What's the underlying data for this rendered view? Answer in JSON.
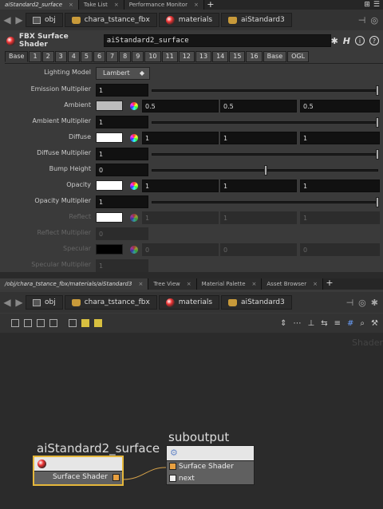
{
  "top_tabs": {
    "tabs": [
      "aiStandard2_surface",
      "Take List",
      "Performance Monitor"
    ],
    "plus": "+"
  },
  "path1": {
    "crumbs": [
      "obj",
      "chara_tstance_fbx",
      "materials",
      "aiStandard3"
    ]
  },
  "header": {
    "type_label": "FBX Surface Shader",
    "node_name": "aiStandard2_surface",
    "help_icon": "H",
    "info_icon": "i"
  },
  "parm_tabs": [
    "Base",
    "1",
    "2",
    "3",
    "4",
    "5",
    "6",
    "7",
    "8",
    "9",
    "10",
    "11",
    "12",
    "13",
    "14",
    "15",
    "16",
    "Base",
    "OGL"
  ],
  "parms": {
    "lighting_model": {
      "label": "Lighting Model",
      "value": "Lambert"
    },
    "emission_mult": {
      "label": "Emission Multiplier",
      "value": "1"
    },
    "ambient": {
      "label": "Ambient",
      "r": "0.5",
      "g": "0.5",
      "b": "0.5"
    },
    "ambient_mult": {
      "label": "Ambient Multiplier",
      "value": "1"
    },
    "diffuse": {
      "label": "Diffuse",
      "r": "1",
      "g": "1",
      "b": "1"
    },
    "diffuse_mult": {
      "label": "Diffuse Multiplier",
      "value": "1"
    },
    "bump_height": {
      "label": "Bump Height",
      "value": "0"
    },
    "opacity": {
      "label": "Opacity",
      "r": "1",
      "g": "1",
      "b": "1"
    },
    "opacity_mult": {
      "label": "Opacity Multiplier",
      "value": "1"
    },
    "reflect": {
      "label": "Reflect",
      "r": "1",
      "g": "1",
      "b": "1"
    },
    "reflect_mult": {
      "label": "Reflect Multiplier",
      "value": "0"
    },
    "specular": {
      "label": "Specular",
      "r": "0",
      "g": "0",
      "b": "0"
    },
    "specular_mult": {
      "label": "Specular Multiplier",
      "value": "1"
    }
  },
  "bottom_tabs": {
    "tabs": [
      "/obj/chara_tstance_fbx/materials/aiStandard3",
      "Tree View",
      "Material Palette",
      "Asset Browser"
    ],
    "plus": "+"
  },
  "path2": {
    "crumbs": [
      "obj",
      "chara_tstance_fbx",
      "materials",
      "aiStandard3"
    ]
  },
  "network": {
    "watermark": "Shader",
    "node1": {
      "name": "aiStandard2_surface",
      "output": "Surface Shader"
    },
    "node2": {
      "name": "suboutput",
      "inputs": [
        "Surface Shader",
        "next"
      ]
    }
  }
}
